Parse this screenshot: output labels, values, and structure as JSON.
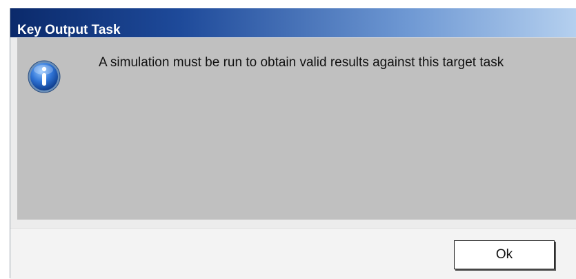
{
  "window": {
    "title": "Key Output Task"
  },
  "message": {
    "text": "A simulation must be run to obtain valid results against this target task",
    "icon": "info-icon"
  },
  "buttons": {
    "ok_label": "Ok"
  },
  "colors": {
    "titlebar_dark": "#0b2a6b",
    "titlebar_light": "#b5d0ef",
    "body_bg": "#c0c0c0",
    "footer_bg": "#f3f3f3"
  }
}
